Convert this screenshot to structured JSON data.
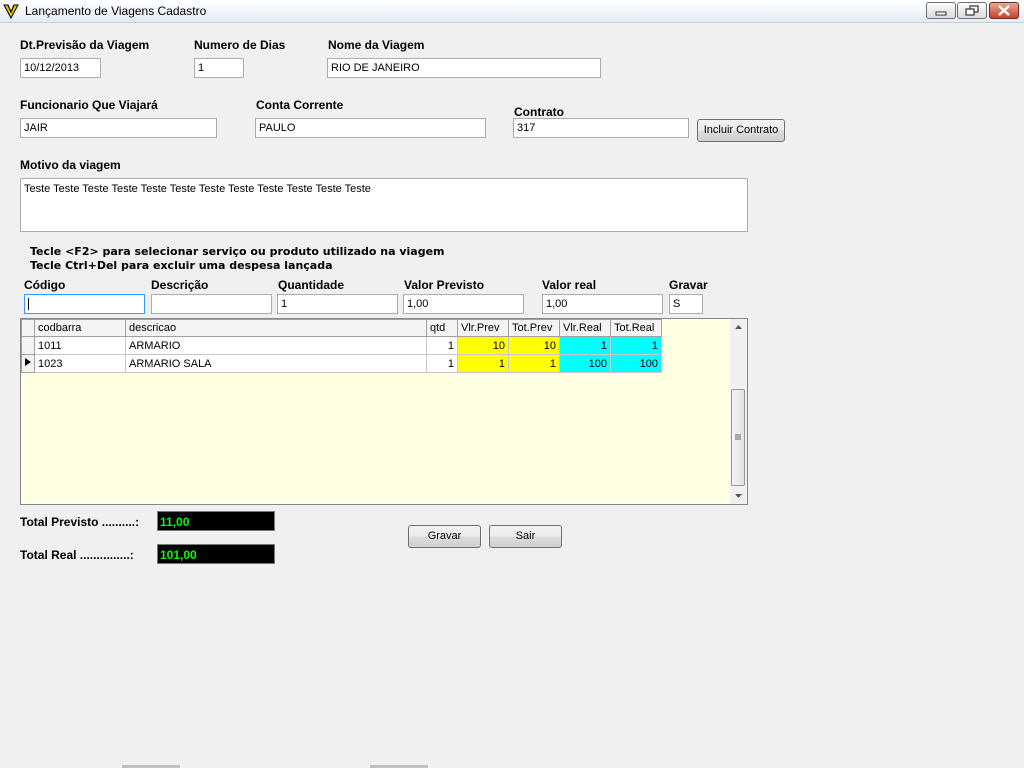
{
  "window": {
    "title": "Lançamento de Viagens Cadastro"
  },
  "form": {
    "dt_previsao": {
      "label": "Dt.Previsão da Viagem",
      "value": "10/12/2013"
    },
    "numero_dias": {
      "label": "Numero de Dias",
      "value": "1"
    },
    "nome_viagem": {
      "label": "Nome da Viagem",
      "value": "RIO DE JANEIRO"
    },
    "funcionario": {
      "label": "Funcionario Que Viajará",
      "value": "JAIR"
    },
    "conta_corrente": {
      "label": "Conta Corrente",
      "value": "PAULO"
    },
    "contrato": {
      "label": "Contrato",
      "value": "317"
    },
    "incluir_contrato_label": "Incluir Contrato",
    "motivo": {
      "label": "Motivo da viagem",
      "value": "Teste  Teste Teste Teste Teste Teste Teste Teste Teste Teste Teste Teste"
    }
  },
  "hints": [
    "Tecle <F2> para selecionar serviço ou produto utilizado na viagem",
    "Tecle Ctrl+Del para excluir uma despesa lançada"
  ],
  "entry": {
    "codigo": {
      "label": "Código",
      "value": ""
    },
    "descricao": {
      "label": "Descrição",
      "value": ""
    },
    "quantidade": {
      "label": "Quantidade",
      "value": "1"
    },
    "valor_previsto": {
      "label": "Valor Previsto",
      "value": "1,00"
    },
    "valor_real": {
      "label": "Valor real",
      "value": "1,00"
    },
    "gravar": {
      "label": "Gravar",
      "value": "S"
    }
  },
  "grid": {
    "columns": [
      "codbarra",
      "descricao",
      "qtd",
      "Vlr.Prev",
      "Tot.Prev",
      "Vlr.Real",
      "Tot.Real"
    ],
    "rows": [
      {
        "codbarra": "1011",
        "descricao": "ARMARIO",
        "qtd": "1",
        "vlr_prev": "10",
        "tot_prev": "10",
        "vlr_real": "1",
        "tot_real": "1"
      },
      {
        "codbarra": "1023",
        "descricao": "ARMARIO SALA",
        "qtd": "1",
        "vlr_prev": "1",
        "tot_prev": "1",
        "vlr_real": "100",
        "tot_real": "100"
      }
    ]
  },
  "totals": {
    "previsto": {
      "label": "Total Previsto ..........:",
      "value": "11,00"
    },
    "real": {
      "label": "Total Real ...............:",
      "value": "101,00"
    }
  },
  "buttons": {
    "gravar": "Gravar",
    "sair": "Sair"
  },
  "colors": {
    "grid_background": "#ffffe1",
    "previsto_cells": "#ffff00",
    "real_cells": "#00ffff",
    "total_text": "#00ff00"
  }
}
